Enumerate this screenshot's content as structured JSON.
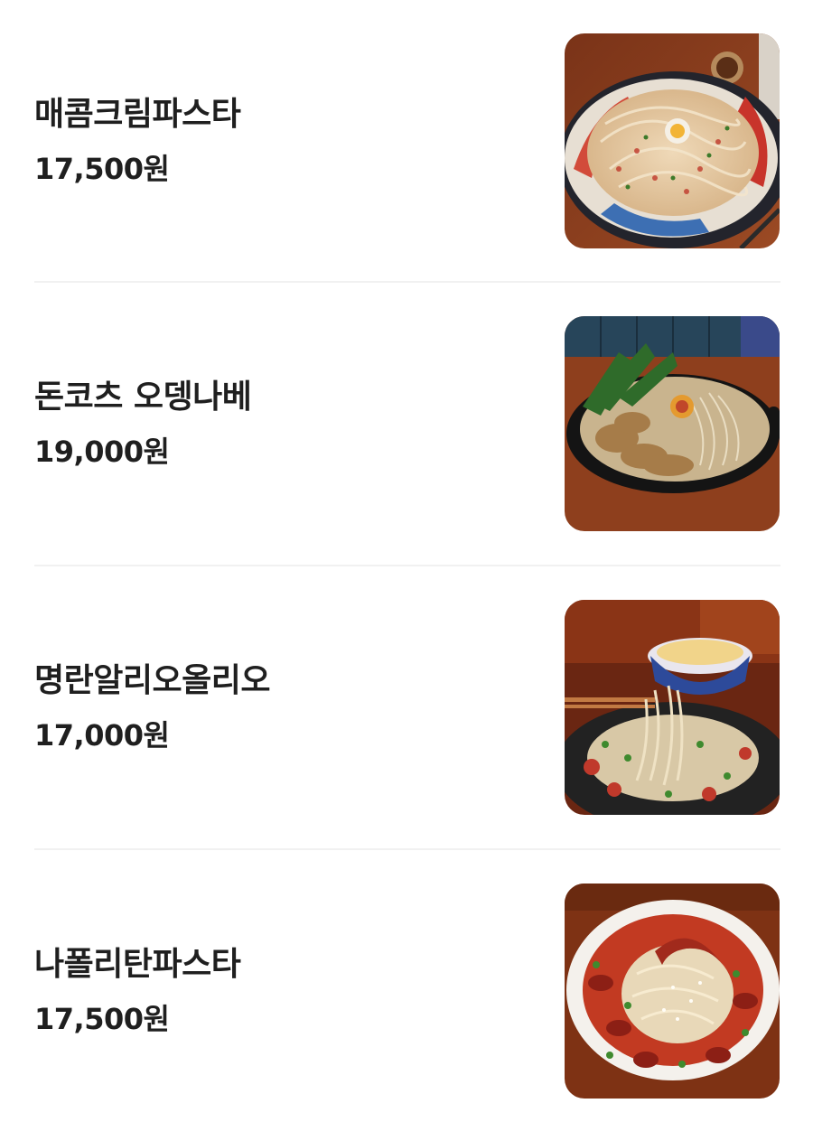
{
  "menu": {
    "items": [
      {
        "name": "매콤크림파스타",
        "price": "17,500원"
      },
      {
        "name": "돈코츠 오뎅나베",
        "price": "19,000원"
      },
      {
        "name": "명란알리오올리오",
        "price": "17,000원"
      },
      {
        "name": "나폴리탄파스타",
        "price": "17,500원"
      }
    ]
  },
  "colors": {
    "text": "#1f1f1f",
    "divider": "#f1f1f1",
    "background": "#ffffff"
  }
}
